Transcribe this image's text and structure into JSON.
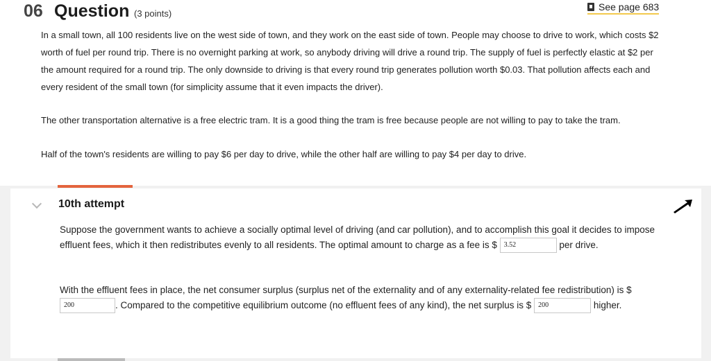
{
  "question": {
    "number": "06",
    "word": "Question",
    "points": "(3 points)",
    "see_page": "See page 683",
    "p1": "In a small town, all 100 residents live on the west side of town, and they work on the east side of town. People may choose to drive to work, which costs $2 worth of fuel per round trip. There is no overnight parking at work, so anybody driving will drive a round trip. The supply of fuel is perfectly elastic at $2 per the amount required for a round trip. The only downside to driving is that every round trip generates pollution worth $0.03. That pollution affects each and every resident of the small town (for simplicity assume that it even impacts the driver).",
    "p2": "The other transportation alternative is a free electric tram. It is a good thing the tram is free because people are not willing to pay to take the tram.",
    "p3": "Half of the town's residents are willing to pay $6 per day to drive, while the other half are willing to pay $4 per day to drive."
  },
  "attempt": {
    "title": "10th attempt",
    "part1_before": "Suppose the government wants to achieve a socially optimal level of driving (and car pollution), and to accomplish this goal it decides to impose effluent fees, which it then redistributes evenly to all residents. The optimal amount to charge as a fee is $",
    "fee_value": "3.52",
    "part1_after": "per drive.",
    "part2_before": "With the effluent fees in place, the net consumer surplus (surplus net of the externality and of any externality-related fee redistribution) is $",
    "surplus_value": "200",
    "part2_middle": ". Compared to the competitive equilibrium outcome (no effluent fees of any kind), the net surplus is $",
    "higher_value": "200",
    "part2_after": "higher."
  },
  "colors": {
    "accent_orange": "#e4643d",
    "link_underline": "#f2c94c",
    "page_bg": "#f1f1f1"
  },
  "icons": [
    "book-icon",
    "chevron-down-icon",
    "pointer-cursor-icon"
  ]
}
